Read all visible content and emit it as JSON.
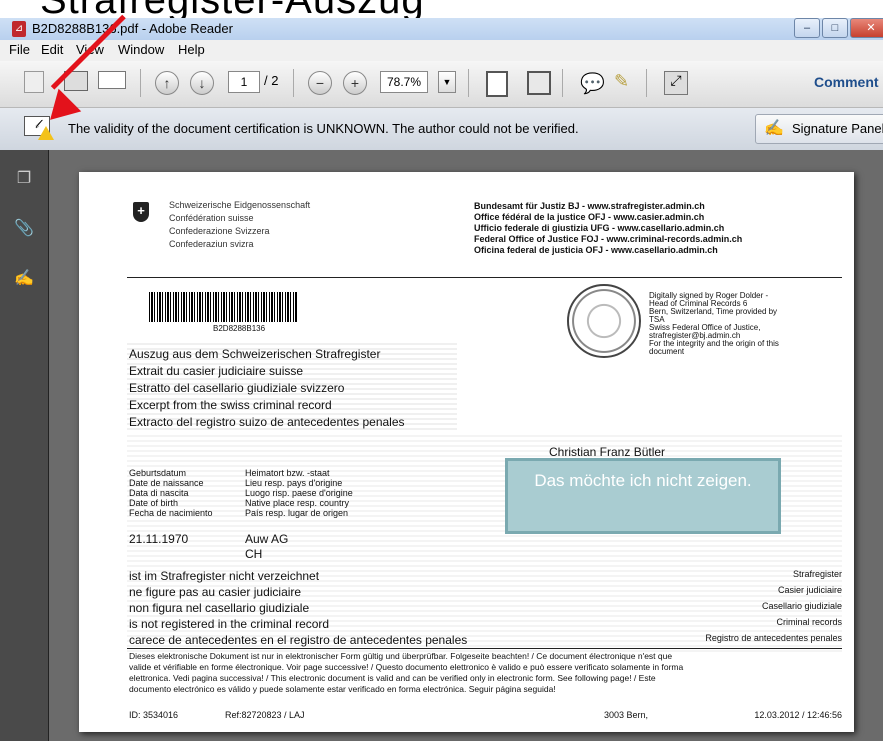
{
  "headline": {
    "text": "Strafregister-Auszug"
  },
  "window": {
    "title": "B2D8288B136.pdf - Adobe Reader",
    "controls": {
      "minimize": "–",
      "maximize": "□",
      "close": "✕"
    }
  },
  "menu": [
    "File",
    "Edit",
    "View",
    "Window",
    "Help"
  ],
  "toolbar": {
    "page_current": "1",
    "page_total": "/ 2",
    "zoom": "78.7%",
    "comment_label": "Comment"
  },
  "signature_bar": {
    "message": "The validity of the document certification is UNKNOWN. The author could not be verified.",
    "panel_label": "Signature Panel"
  },
  "document": {
    "confed": [
      "Schweizerische Eidgenossenschaft",
      "Confédération suisse",
      "Confederazione Svizzera",
      "Confederaziun svizra"
    ],
    "offices": [
      "Bundesamt für Justiz BJ - www.strafregister.admin.ch",
      "Office fédéral de la justice OFJ - www.casier.admin.ch",
      "Ufficio federale di giustizia UFG - www.casellario.admin.ch",
      "Federal Office of Justice FOJ - www.criminal-records.admin.ch",
      "Oficina federal de justicia OFJ - www.casellario.admin.ch"
    ],
    "barcode_id": "B2D8288B136",
    "signature_info": [
      "Digitally signed by Roger Dolder -",
      "Head of Criminal Records 6",
      "Bern, Switzerland, Time provided by",
      "TSA",
      "Swiss Federal Office of Justice,",
      "strafregister@bj.admin.ch",
      "For the integrity and the origin of this",
      "document"
    ],
    "extract_titles": [
      "Auszug aus dem Schweizerischen Strafregister",
      "Extrait du casier judiciaire suisse",
      "Estratto del casellario giudiziale svizzero",
      "Excerpt from the swiss criminal record",
      "Extracto del registro suizo de antecedentes penales"
    ],
    "person_name": "Christian Franz Bütler",
    "birth_labels": [
      "Geburtsdatum",
      "Date de naissance",
      "Data di nascita",
      "Date of birth",
      "Fecha de nacimiento"
    ],
    "origin_labels": [
      "Heimatort bzw. -staat",
      "Lieu resp. pays d'origine",
      "Luogo risp. paese d'origine",
      "Native place resp. country",
      "País resp. lugar de origen"
    ],
    "birth_date": "21.11.1970",
    "origin_place": "Auw AG",
    "origin_country": "CH",
    "status_lines": [
      "ist im Strafregister nicht verzeichnet",
      "ne figure pas au casier judiciaire",
      "non figura nel casellario giudiziale",
      "is not registered in the criminal record",
      "carece de antecedentes en el registro de antecedentes penales"
    ],
    "register_names": [
      "Strafregister",
      "Casier judiciaire",
      "Casellario giudiziale",
      "Criminal records",
      "Registro de antecedentes penales"
    ],
    "disclaimer": [
      "Dieses elektronische Dokument ist nur in elektronischer Form gültig und überprüfbar. Folgeseite beachten! / Ce document électronique n'est que",
      "valide et vérifiable en forme électronique. Voir page successive! / Questo documento elettronico è valido e può essere verificato solamente in forma",
      "elettronica. Vedi pagina successiva! / This electronic document is valid and can be verified only in electronic form. See following page! / Este",
      "documento electrónico es válido y puede solamente estar verificado en forma electrónica. Seguir página seguida!"
    ],
    "footer": {
      "id": "ID:  3534016",
      "ref": "Ref:82720823 / LAJ",
      "place": "3003 Bern,",
      "datetime": "12.03.2012  /  12:46:56"
    }
  },
  "overlay_note": "Das möchte ich nicht zeigen.",
  "colors": {
    "arrow": "#e3121b",
    "overlay": "#a9ccd1",
    "sidebar": "#4a4a4a",
    "workspace": "#6b6b6b"
  }
}
